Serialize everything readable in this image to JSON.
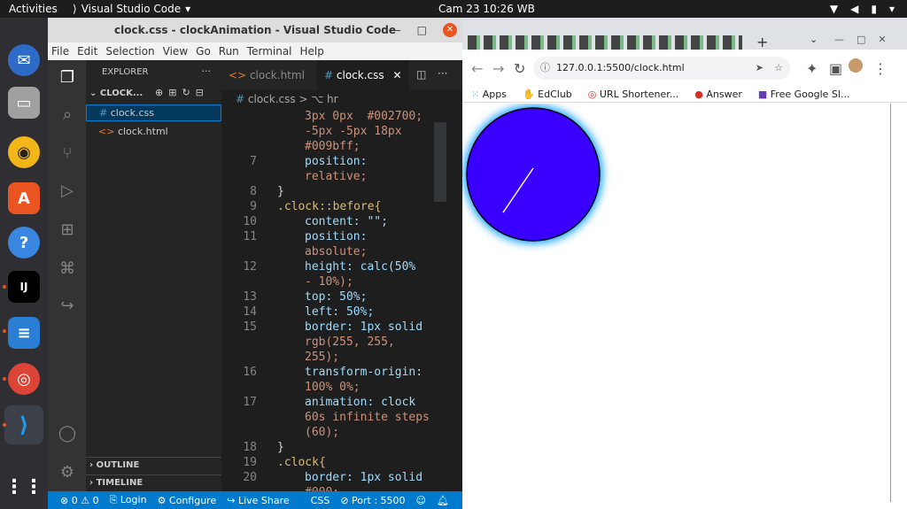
{
  "topbar": {
    "activities": "Activities",
    "app": "Visual Studio Code",
    "clock": "Cam 23  10:26 WB"
  },
  "dock": {
    "icons": [
      "thunderbird-icon",
      "files-icon",
      "rhythmbox-icon",
      "software-center-icon",
      "help-icon",
      "intellij-icon",
      "text-editor-icon",
      "chrome-icon",
      "vscode-icon"
    ]
  },
  "vscode": {
    "title": "clock.css - clockAnimation - Visual Studio Code",
    "menu": [
      "File",
      "Edit",
      "Selection",
      "View",
      "Go",
      "Run",
      "Terminal",
      "Help"
    ],
    "explorer": {
      "heading": "EXPLORER",
      "folder": "CLOCK...",
      "files": [
        {
          "name": "clock.css",
          "icon": "#"
        },
        {
          "name": "clock.html",
          "icon": "<>"
        }
      ],
      "outline": "OUTLINE",
      "timeline": "TIMELINE"
    },
    "tabs": [
      {
        "label": "clock.html",
        "icon": "<>"
      },
      {
        "label": "clock.css",
        "icon": "#"
      }
    ],
    "breadcrumb": {
      "file": "clock.css",
      "sep": ">",
      "item": "hr"
    },
    "code": [
      {
        "n": "",
        "t": "3px 0px  #002700;"
      },
      {
        "n": "",
        "t": "-5px -5px 18px"
      },
      {
        "n": "",
        "t": "#009bff;"
      },
      {
        "n": "7",
        "t": "position:"
      },
      {
        "n": "",
        "t": "relative;"
      },
      {
        "n": "8",
        "t": "}"
      },
      {
        "n": "9",
        "t": ".clock::before{"
      },
      {
        "n": "10",
        "t": "content: \"\";"
      },
      {
        "n": "11",
        "t": "position:"
      },
      {
        "n": "",
        "t": "absolute;"
      },
      {
        "n": "12",
        "t": "height: calc(50%"
      },
      {
        "n": "",
        "t": "- 10%);"
      },
      {
        "n": "13",
        "t": "top: 50%;"
      },
      {
        "n": "14",
        "t": "left: 50%;"
      },
      {
        "n": "15",
        "t": "border: 1px solid"
      },
      {
        "n": "",
        "t": "rgb(255, 255,"
      },
      {
        "n": "",
        "t": "255);"
      },
      {
        "n": "16",
        "t": "transform-origin:"
      },
      {
        "n": "",
        "t": "100% 0%;"
      },
      {
        "n": "17",
        "t": "animation: clock"
      },
      {
        "n": "",
        "t": "60s infinite steps"
      },
      {
        "n": "",
        "t": "(60);"
      },
      {
        "n": "18",
        "t": "}"
      },
      {
        "n": "19",
        "t": ".clock{"
      },
      {
        "n": "20",
        "t": "border: 1px solid"
      },
      {
        "n": "",
        "t": "#000;"
      }
    ],
    "status": {
      "errors": "0",
      "warnings": "0",
      "login": "Login",
      "configure": "Configure",
      "liveshare": "Live Share",
      "lang": "CSS",
      "port": "Port : 5500"
    }
  },
  "chrome": {
    "url": "127.0.0.1:5500/clock.html",
    "bookmarks": [
      "Apps",
      "EdClub",
      "URL Shortener...",
      "Answer",
      "Free Google Sl..."
    ],
    "clock": {
      "face_color": "#3a00ff",
      "glow": "#009bff",
      "hand_angle_deg": 35
    }
  }
}
